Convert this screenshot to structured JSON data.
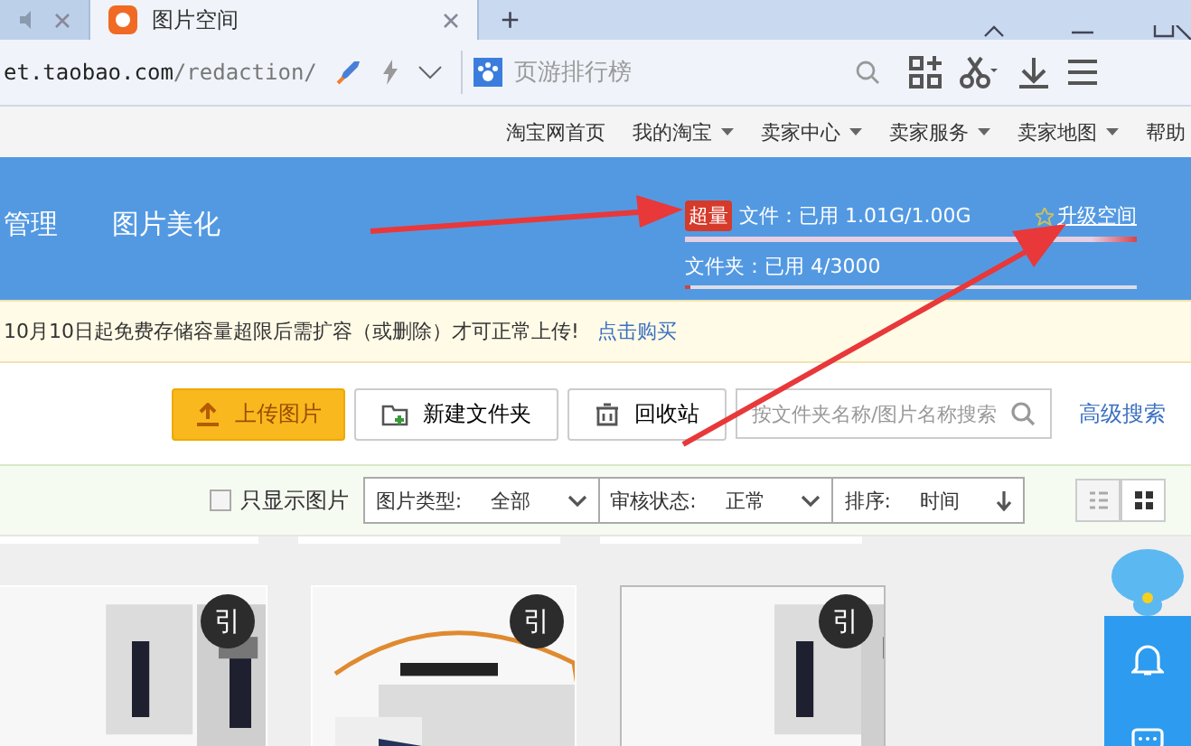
{
  "browser": {
    "tabs": [
      {
        "muted": true,
        "selected": false
      },
      {
        "label": "图片空间",
        "muted": false,
        "selected": true
      }
    ],
    "new_tab": "+",
    "address": {
      "host": "et.taobao.com",
      "path": "/redaction/"
    },
    "search": {
      "placeholder": "页游排行榜"
    }
  },
  "site_nav": [
    "淘宝网首页",
    "我的淘宝",
    "卖家中心",
    "卖家服务",
    "卖家地图",
    "帮助"
  ],
  "header": {
    "nav": [
      "管理",
      "图片美化"
    ],
    "over_badge": "超量",
    "files": {
      "label": "文件：已用 1.01G/1.00G",
      "level": 1
    },
    "upgrade": "升级空间",
    "folders": {
      "label": "文件夹：已用 4/3000",
      "level": 0.01
    }
  },
  "notice": {
    "text": "10月10日起免费存储容量超限后需扩容（或删除）才可正常上传!",
    "link": "点击购买"
  },
  "toolbar": {
    "upload": "上传图片",
    "new_folder": "新建文件夹",
    "recycle": "回收站",
    "search": {
      "placeholder": "按文件夹名称/图片名称搜索"
    },
    "advanced": "高级搜索"
  },
  "filters": {
    "only_images": {
      "label": "只显示图片",
      "checked": false
    },
    "selects": [
      {
        "label": "图片类型:",
        "value": "全部",
        "kind": "select"
      },
      {
        "label": "审核状态:",
        "value": "正常",
        "kind": "select"
      },
      {
        "label": "排序:",
        "value": "时间",
        "kind": "sort"
      }
    ],
    "views": [
      {
        "kind": "list",
        "selected": false
      },
      {
        "kind": "grid",
        "selected": true
      }
    ]
  },
  "cards": [
    {
      "kind": "picture",
      "badge": "引",
      "selected": false
    },
    {
      "kind": "picture",
      "badge": "引",
      "selected": false
    },
    {
      "kind": "picture",
      "badge": "引",
      "selected": true
    }
  ]
}
